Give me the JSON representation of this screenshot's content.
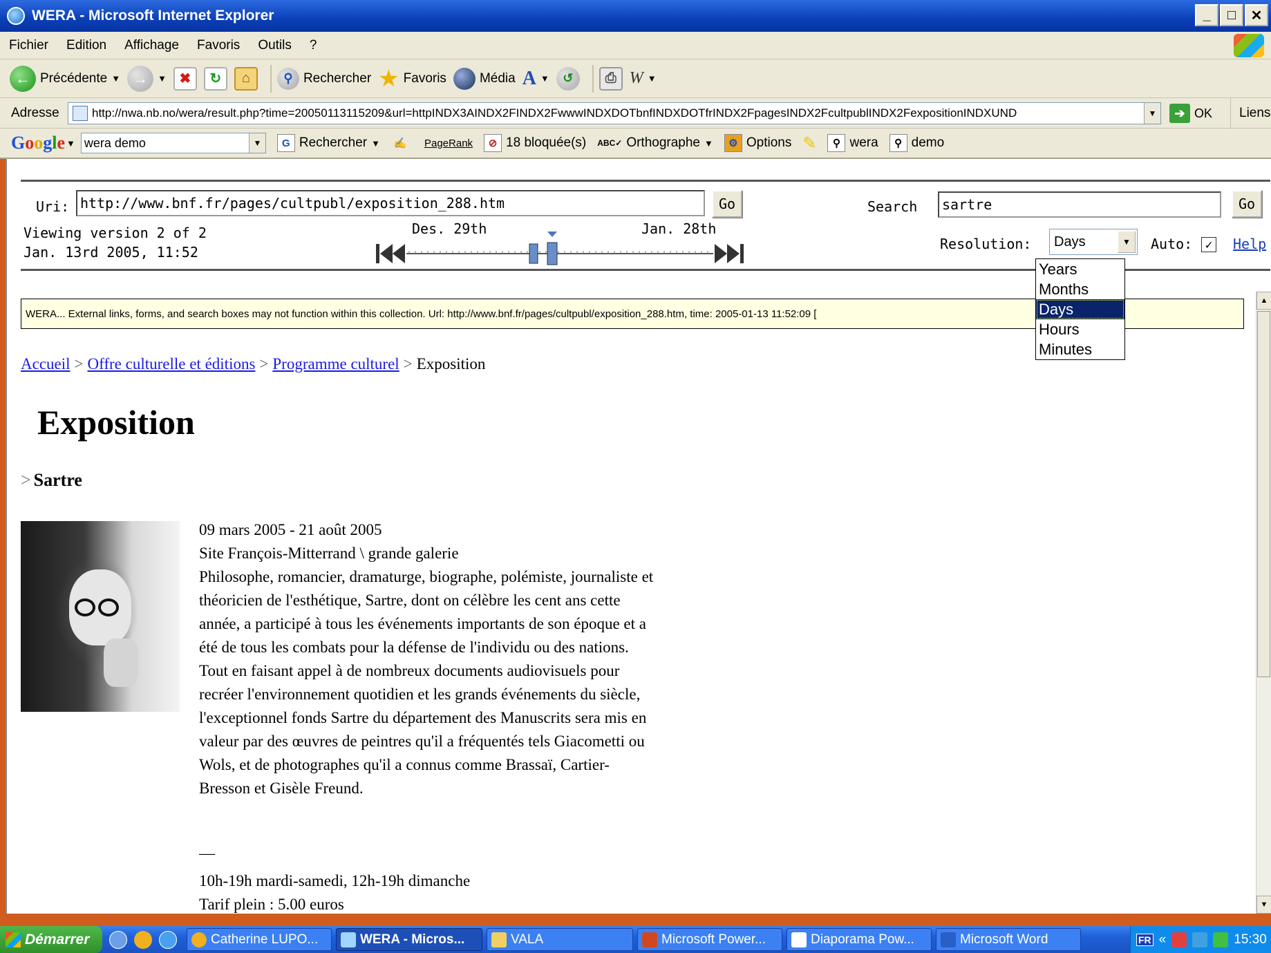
{
  "window": {
    "title": "WERA - Microsoft Internet Explorer",
    "buttons": [
      "_",
      "□",
      "✕"
    ]
  },
  "menu": [
    "Fichier",
    "Edition",
    "Affichage",
    "Favoris",
    "Outils",
    "?"
  ],
  "toolbar": {
    "back": "Précédente",
    "search": "Rechercher",
    "favorites": "Favoris",
    "media": "Média"
  },
  "address": {
    "label": "Adresse",
    "url": "http://nwa.nb.no/wera/result.php?time=20050113115209&url=httpINDX3AINDX2FINDX2FwwwINDXDOTbnfINDXDOTfrINDX2FpagesINDX2FcultpublINDX2FexpositionINDXUND",
    "go": "OK",
    "links": "Liens"
  },
  "google": {
    "query": "wera demo",
    "search": "Rechercher",
    "pagerank": "PageRank",
    "blocked": "18 bloquée(s)",
    "spell": "Orthographe",
    "options": "Options",
    "hl1": "wera",
    "hl2": "demo"
  },
  "wera": {
    "uri_label": "Uri:",
    "uri": "http://www.bnf.fr/pages/cultpubl/exposition_288.htm",
    "go": "Go",
    "search_label": "Search",
    "search_value": "sartre",
    "search_go": "Go",
    "version_line1": "Viewing version 2 of 2",
    "version_line2": "Jan. 13rd 2005, 11:52",
    "timeline_start": "Des. 29th",
    "timeline_end": "Jan. 28th",
    "resolution_label": "Resolution:",
    "resolution_value": "Days",
    "resolution_options": [
      "Years",
      "Months",
      "Days",
      "Hours",
      "Minutes"
    ],
    "auto_label": "Auto:",
    "auto_checked": "✓",
    "help": "Help"
  },
  "banner": "WERA... External links, forms, and search boxes may not function within this collection. Url: http://www.bnf.fr/pages/cultpubl/exposition_288.htm, time: 2005-01-13 11:52:09 [",
  "page": {
    "breadcrumbs": [
      "Accueil",
      "Offre culturelle et éditions",
      "Programme culturel"
    ],
    "breadcrumb_current": "Exposition",
    "breadcrumb_sep": ">",
    "title": "Exposition",
    "subtitle_marker": ">",
    "subtitle": "Sartre",
    "dates": "09 mars 2005 - 21 août 2005",
    "location": "Site François-Mitterrand \\ grande galerie",
    "description": [
      "Philosophe, romancier, dramaturge, biographe, polémiste, journaliste et",
      "théoricien de l'esthétique, Sartre, dont on célèbre les cent ans cette",
      "année, a participé à tous les événements importants de son époque et a",
      "été de tous les combats pour la défense de l'individu ou des nations.",
      "Tout en faisant appel à de nombreux documents audiovisuels pour",
      "recréer l'environnement quotidien et les grands événements du siècle,",
      "l'exceptionnel fonds Sartre du département des Manuscrits sera mis en",
      "valeur par des œuvres de peintres qu'il a fréquentés tels Giacometti ou",
      "Wols, et de photographes qu'il a connus comme Brassaï, Cartier-",
      "Bresson et Gisèle Freund."
    ],
    "dash": "—",
    "hours": "10h-19h mardi-samedi, 12h-19h dimanche",
    "tariff": "Tarif plein : 5.00 euros"
  },
  "taskbar": {
    "start": "Démarrer",
    "tasks": [
      "Catherine LUPO...",
      "WERA - Micros...",
      "VALA",
      "Microsoft Power...",
      "Diaporama Pow...",
      "Microsoft Word"
    ],
    "lang": "FR",
    "chevron": "«",
    "clock": "15:30"
  },
  "colors": {
    "titlebar": "#0a3fb8",
    "link": "#1a1ae6",
    "banner_bg": "#ffffe1",
    "selected_option": "#0a246a",
    "slide_frame": "#d05c1e"
  }
}
